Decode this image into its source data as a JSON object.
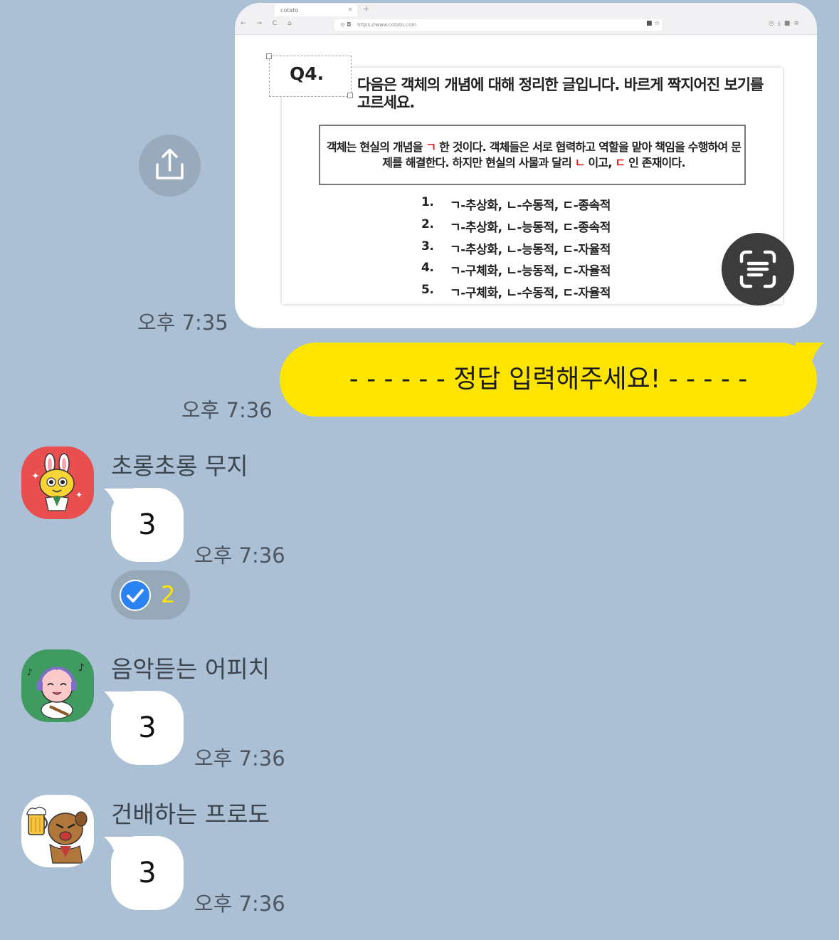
{
  "screenshot": {
    "tab_title": "cotato",
    "tab_close": "×",
    "tab_new": "+",
    "nav_buttons": "← → C ⌂",
    "url": "https://www.cotato.com",
    "question_label": "Q4.",
    "question_text": "다음은 객체의 개념에 대해 정리한 글입니다. 바르게 짝지어진 보기를 고르세요.",
    "box_text": {
      "part1": "객체는 현실의 개념을 ",
      "mark1": "ㄱ",
      "part2": " 한 것이다. 객체들은 서로 협력하고 역할을 맡아 책임을 수행하여 문제를 해결한다. 하지만 현실의 사물과 달리 ",
      "mark2": "ㄴ",
      "part3": " 이고, ",
      "mark3": "ㄷ",
      "part4": " 인 존재이다."
    },
    "options": [
      {
        "num": "1.",
        "text": "ㄱ-추상화, ㄴ-수동적, ㄷ-종속적"
      },
      {
        "num": "2.",
        "text": "ㄱ-추상화, ㄴ-능동적, ㄷ-종속적"
      },
      {
        "num": "3.",
        "text": "ㄱ-추상화, ㄴ-능동적, ㄷ-자율적"
      },
      {
        "num": "4.",
        "text": "ㄱ-구체화, ㄴ-능동적, ㄷ-자율적"
      },
      {
        "num": "5.",
        "text": "ㄱ-구체화, ㄴ-수동적, ㄷ-자율적"
      }
    ]
  },
  "messages": {
    "image_time": "오후 7:35",
    "my_message": "- - - - - - 정답 입력해주세요! - - - - -",
    "my_message_time": "오후 7:36",
    "incoming": [
      {
        "name": "초롱초롱 무지",
        "text": "3",
        "time": "오후 7:36"
      },
      {
        "name": "음악듣는 어피치",
        "text": "3",
        "time": "오후 7:36"
      },
      {
        "name": "건배하는 프로도",
        "text": "3",
        "time": "오후 7:36"
      }
    ],
    "reaction_count": "2"
  },
  "icons": {
    "share": "share-icon",
    "scan": "text-scan-icon",
    "reaction": "check-icon"
  },
  "colors": {
    "background": "#abc0d4",
    "my_bubble": "#fee500",
    "their_bubble": "#ffffff",
    "reaction_check": "#2a83f2"
  }
}
